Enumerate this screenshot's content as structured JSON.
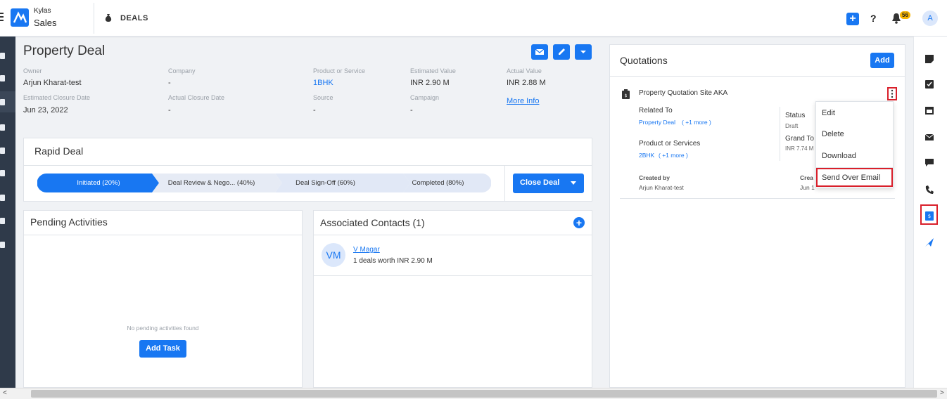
{
  "app": {
    "brand_top": "Kylas",
    "brand_bottom": "Sales",
    "section": "DEALS",
    "notification_count": "56",
    "avatar_initial": "A"
  },
  "deal": {
    "title": "Property Deal",
    "fields": {
      "owner_label": "Owner",
      "owner_value": "Arjun Kharat-test",
      "company_label": "Company",
      "company_value": "-",
      "product_label": "Product or Service",
      "product_value": "1BHK",
      "est_value_label": "Estimated Value",
      "est_value_value": "INR 2.90 M",
      "actual_value_label": "Actual Value",
      "actual_value_value": "INR 2.88 M",
      "est_close_label": "Estimated Closure Date",
      "est_close_value": "Jun 23, 2022",
      "actual_close_label": "Actual Closure Date",
      "actual_close_value": "-",
      "source_label": "Source",
      "source_value": "-",
      "campaign_label": "Campaign",
      "campaign_value": "-",
      "more_info": "More Info"
    }
  },
  "pipeline": {
    "title": "Rapid Deal",
    "stages": [
      "Initiated (20%)",
      "Deal Review & Nego... (40%)",
      "Deal Sign-Off (60%)",
      "Completed (80%)"
    ],
    "close_button": "Close Deal"
  },
  "activities": {
    "title": "Pending Activities",
    "empty_text": "No pending activities found",
    "add_button": "Add Task"
  },
  "contacts": {
    "title": "Associated Contacts (1)",
    "initials": "VM",
    "name": "V Magar",
    "detail": "1 deals worth INR 2.90 M"
  },
  "quotations": {
    "title": "Quotations",
    "add_button": "Add",
    "item": {
      "name": "Property Quotation Site AKA",
      "related_label": "Related To",
      "related_value": "Property Deal",
      "related_more": "( +1 more )",
      "product_label": "Product or Services",
      "product_value": "2BHK",
      "product_more": "( +1 more )",
      "status_label": "Status",
      "status_value": "Draft",
      "grand_label": "Grand To",
      "grand_value": "INR 7.74 M",
      "created_by_label": "Created by",
      "created_by_value": "Arjun Kharat-test",
      "created_on_label": "Crea",
      "created_on_value": "Jun 1"
    },
    "menu": [
      "Edit",
      "Delete",
      "Download",
      "Send Over Email"
    ]
  },
  "colors": {
    "accent": "#1877f2",
    "highlight": "#d9202b",
    "nav": "#2f3a4a"
  }
}
